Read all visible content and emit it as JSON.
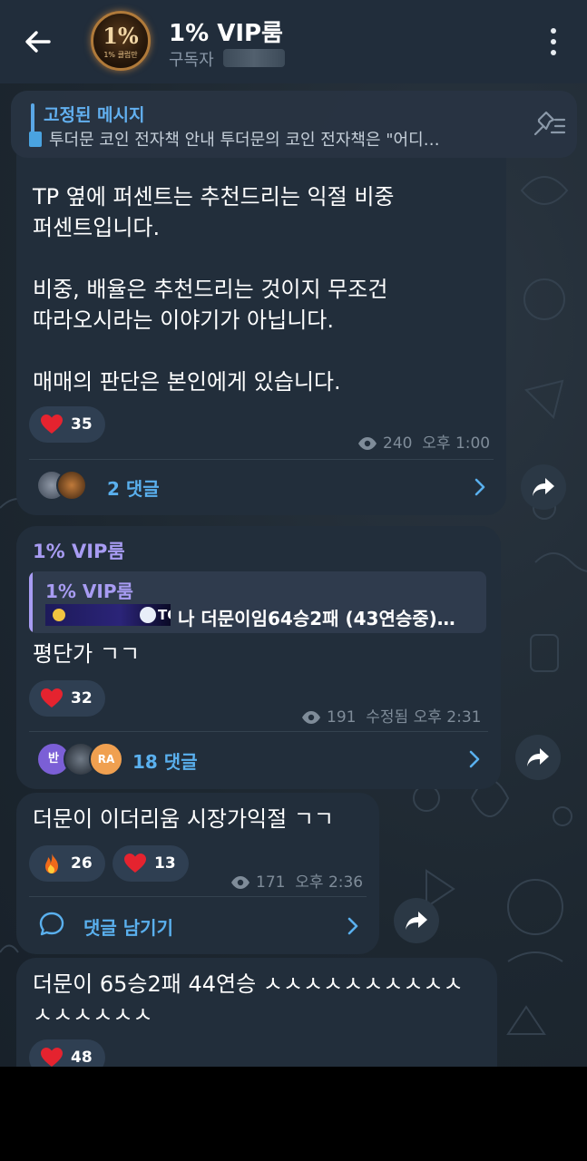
{
  "header": {
    "title": "1% VIP룸",
    "subtitle": "구독자",
    "avatar_text_big": "1%",
    "avatar_text_small": "1% 클럽만"
  },
  "pinned": {
    "title": "고정된 메시지",
    "text": "투더문 코인 전자책 안내  투더문의 코인 전자책은 \"어디…"
  },
  "messages": [
    {
      "text": "TP 옆에 퍼센트는 추천드리는 익절 비중\n퍼센트입니다.\n\n비중, 배율은 추천드리는 것이지 무조건\n따라오시라는 이야기가 아닙니다.\n\n매매의 판단은 본인에게 있습니다.",
      "reactions": [
        {
          "emoji": "heart",
          "count": "35"
        }
      ],
      "views": "240",
      "time": "오후 1:00",
      "comments": "2 댓글"
    },
    {
      "channel": "1% VIP룸",
      "forward_channel": "1% VIP룸",
      "forward_text": "나 더문이임64승2패 (43연승중)…",
      "forward_thumb_text": "TC",
      "text": "평단가 ㄱㄱ",
      "reactions": [
        {
          "emoji": "heart",
          "count": "32"
        }
      ],
      "views": "191",
      "time": "수정됨 오후 2:31",
      "comments": "18 댓글",
      "commenter_initials": [
        "반",
        "",
        "RA"
      ]
    },
    {
      "text": "더문이 이더리움 시장가익절 ㄱㄱ",
      "reactions": [
        {
          "emoji": "fire",
          "count": "26"
        },
        {
          "emoji": "heart",
          "count": "13"
        }
      ],
      "views": "171",
      "time": "오후 2:36",
      "comments": "댓글 남기기"
    },
    {
      "text": "더문이 65승2패 44연승 ㅅㅅㅅㅅㅅㅅㅅㅅㅅㅅ\nㅅㅅㅅㅅㅅㅅ",
      "reactions": [
        {
          "emoji": "heart",
          "count": "48"
        }
      ]
    }
  ],
  "colors": {
    "accent_blue": "#5ab0ee",
    "channel_purple": "#a89cf3",
    "bubble": "#222e3b",
    "reaction_bg": "#2f3f52",
    "heart": "#e5232f"
  }
}
